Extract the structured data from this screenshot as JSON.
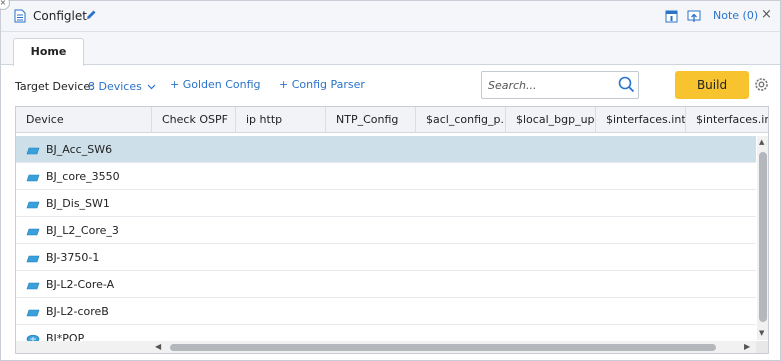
{
  "window": {
    "title": "Configlet",
    "note_label": "Note (0)",
    "close_glyph": "×",
    "corner_close_glyph": "×"
  },
  "tabs": [
    {
      "label": "Home",
      "active": true
    }
  ],
  "toolbar": {
    "target_label": "Target Device:",
    "target_value": "8 Devices",
    "golden_config": "+ Golden Config",
    "config_parser": "+ Config Parser",
    "search_placeholder": "Search...",
    "build_label": "Build"
  },
  "grid": {
    "columns": [
      "Device",
      "Check OSPF",
      "ip http",
      "NTP_Config",
      "$acl_config_p...",
      "$local_bgp_up...",
      "$interfaces.intf",
      "$interfaces.int..."
    ],
    "rows": [
      {
        "label": "BJ_Acc_SW6",
        "icon": "switch-icon",
        "selected": true
      },
      {
        "label": "BJ_core_3550",
        "icon": "switch-icon",
        "selected": false
      },
      {
        "label": "BJ_Dis_SW1",
        "icon": "switch-icon",
        "selected": false
      },
      {
        "label": "BJ_L2_Core_3",
        "icon": "switch-icon",
        "selected": false
      },
      {
        "label": "BJ-3750-1",
        "icon": "switch-icon",
        "selected": false
      },
      {
        "label": "BJ-L2-Core-A",
        "icon": "switch-icon",
        "selected": false
      },
      {
        "label": "BJ-L2-coreB",
        "icon": "switch-icon",
        "selected": false
      },
      {
        "label": "BJ*POP",
        "icon": "router-icon",
        "selected": false
      }
    ]
  },
  "colors": {
    "accent": "#2a73c9",
    "build_button": "#f7c430",
    "selected_row": "#cde0ea"
  }
}
